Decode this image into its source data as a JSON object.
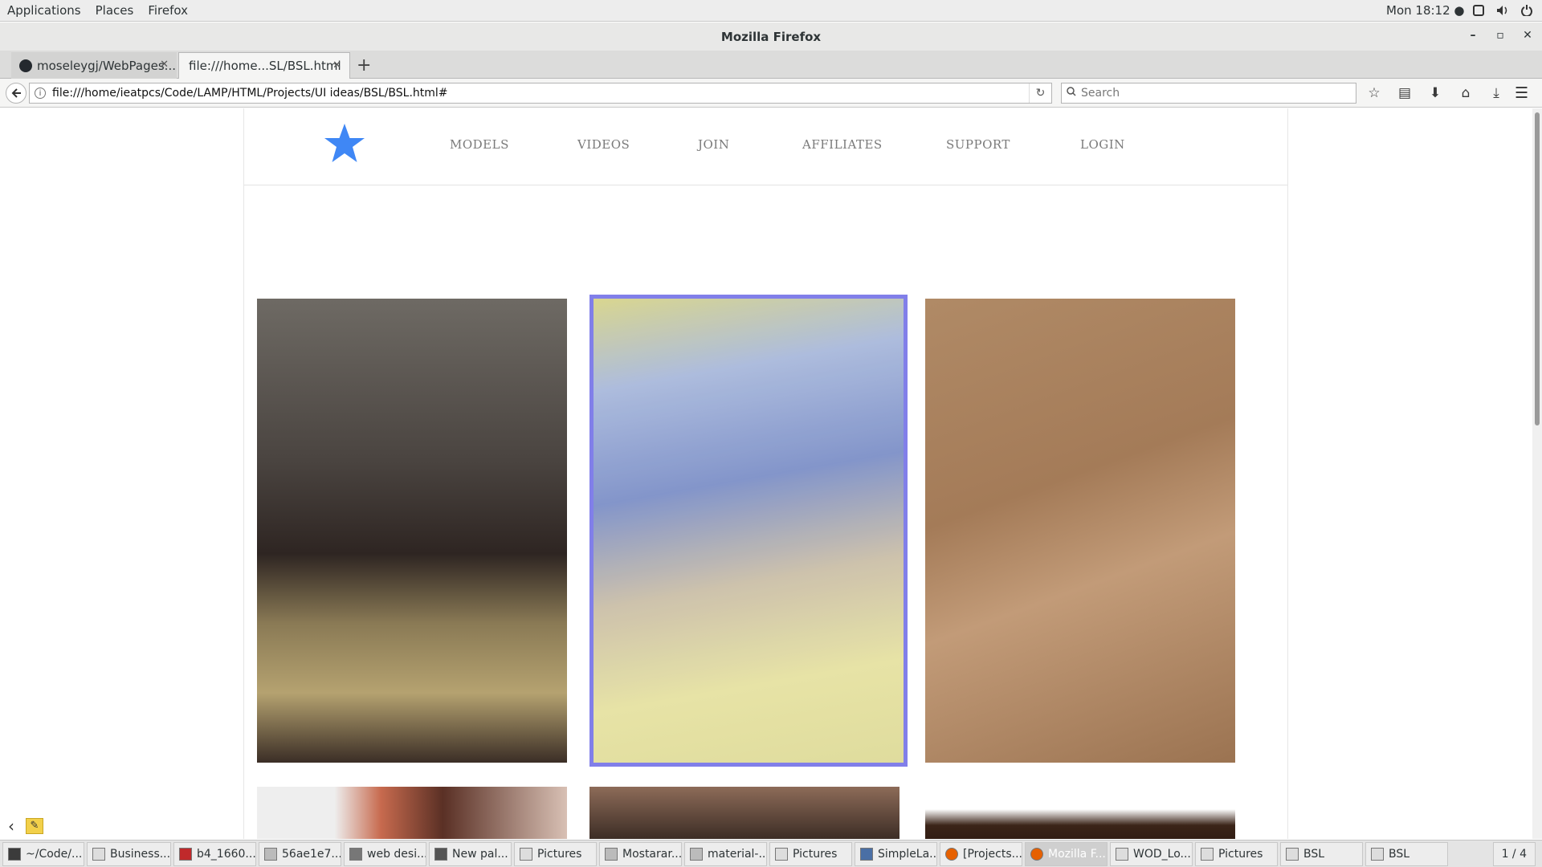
{
  "top_bar": {
    "menus": [
      "Applications",
      "Places",
      "Firefox"
    ],
    "clock": "Mon 18:12 ●"
  },
  "window": {
    "title": "Mozilla Firefox"
  },
  "tabs": [
    {
      "label": "moseleygj/WebPages...",
      "active": false
    },
    {
      "label": "file:///home...SL/BSL.html",
      "active": true
    }
  ],
  "navbar": {
    "url": "file:///home/ieatpcs/Code/LAMP/HTML/Projects/UI ideas/BSL/BSL.html#",
    "search_placeholder": "Search"
  },
  "site": {
    "nav": [
      "MODELS",
      "VIDEOS",
      "JOIN",
      "AFFILIATES",
      "SUPPORT",
      "LOGIN"
    ],
    "logo_color": "#3f87f5",
    "selected_border_color": "#7b79e8"
  },
  "taskbar": {
    "tasks": [
      {
        "label": "~/Code/...",
        "icon": "terminal-icon"
      },
      {
        "label": "Business...",
        "icon": "window-icon"
      },
      {
        "label": "b4_1660...",
        "icon": "filezilla-icon"
      },
      {
        "label": "56ae1e7...",
        "icon": "image-viewer-icon"
      },
      {
        "label": "web desi...",
        "icon": "drawing-icon"
      },
      {
        "label": "New pal...",
        "icon": "color-picker-icon"
      },
      {
        "label": "Pictures",
        "icon": "window-icon"
      },
      {
        "label": "Mostarar...",
        "icon": "image-viewer-icon"
      },
      {
        "label": "material-...",
        "icon": "image-viewer-icon"
      },
      {
        "label": "Pictures",
        "icon": "window-icon"
      },
      {
        "label": "SimpleLa...",
        "icon": "editor-icon"
      },
      {
        "label": "[Projects...",
        "icon": "firefox-icon"
      },
      {
        "label": "Mozilla F...",
        "icon": "firefox-icon",
        "active": true
      },
      {
        "label": "WOD_Lo...",
        "icon": "window-icon"
      },
      {
        "label": "Pictures",
        "icon": "window-icon"
      },
      {
        "label": "BSL",
        "icon": "window-icon"
      },
      {
        "label": "BSL",
        "icon": "window-icon"
      }
    ],
    "workspace": "1 / 4"
  }
}
